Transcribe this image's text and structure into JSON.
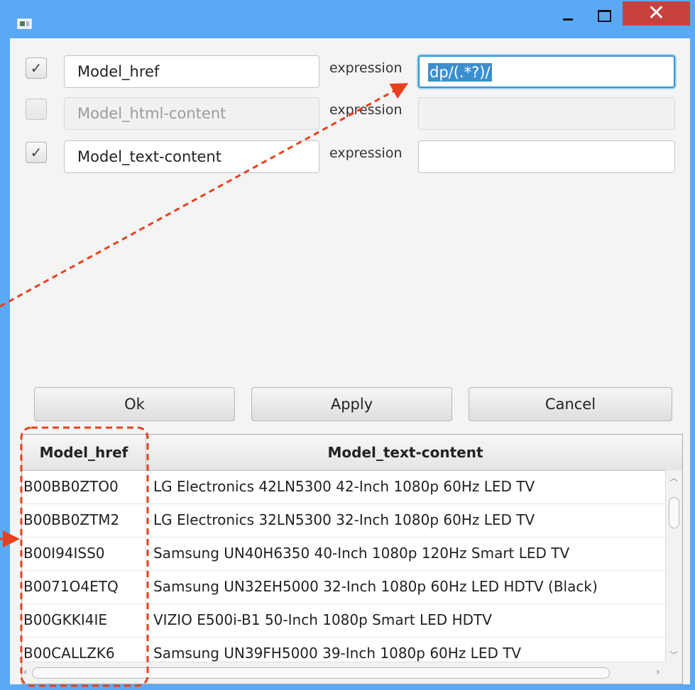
{
  "window": {
    "controls": {
      "minimize_icon": "minimize-icon",
      "maximize_icon": "maximize-icon",
      "close_label": "✕"
    }
  },
  "fields": [
    {
      "checked": true,
      "name": "Model_href",
      "expression_label": "expression",
      "expression_value": "dp/(.*?)/",
      "enabled": true
    },
    {
      "checked": false,
      "name": "Model_html-content",
      "expression_label": "expression",
      "expression_value": "",
      "enabled": false
    },
    {
      "checked": true,
      "name": "Model_text-content",
      "expression_label": "expression",
      "expression_value": "",
      "enabled": true
    }
  ],
  "buttons": {
    "ok": "Ok",
    "apply": "Apply",
    "cancel": "Cancel"
  },
  "table": {
    "columns": [
      "Model_href",
      "Model_text-content"
    ],
    "rows": [
      [
        "B00BB0ZTO0",
        "LG Electronics 42LN5300 42-Inch 1080p 60Hz LED TV"
      ],
      [
        "B00BB0ZTM2",
        "LG Electronics 32LN5300 32-Inch 1080p 60Hz LED TV"
      ],
      [
        "B00I94ISS0",
        "Samsung UN40H6350 40-Inch 1080p 120Hz Smart LED TV"
      ],
      [
        "B0071O4ETQ",
        "Samsung UN32EH5000 32-Inch 1080p 60Hz LED HDTV (Black)"
      ],
      [
        "B00GKKI4IE",
        "VIZIO E500i-B1 50-Inch 1080p Smart LED HDTV"
      ],
      [
        "B00CALLZK6",
        "Samsung UN39FH5000 39-Inch 1080p 60Hz LED TV"
      ]
    ]
  },
  "colors": {
    "window_frame": "#5aa9f5",
    "close_button": "#c7413f",
    "annotation": "#e8401c",
    "selection": "#3b8fcf"
  }
}
